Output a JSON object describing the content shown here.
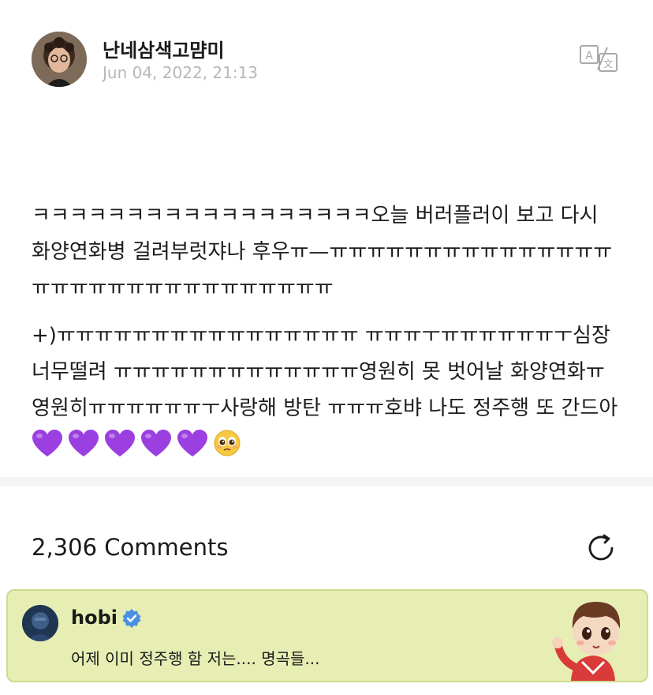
{
  "post": {
    "author": "난네삼색고먐미",
    "date": "Jun 04, 2022, 21:13",
    "body_line1": "ㅋㅋㅋㅋㅋㅋㅋㅋㅋㅋㅋㅋㅋㅋㅋㅋㅋㅋ오늘 버러플러이 보고 다시 화양연화병 걸려부럿쟈나 후우ㅠ—ㅠㅠㅠㅠㅠㅠㅠㅠㅠㅠㅠㅠㅠㅠㅠㅠㅠㅠㅠㅠㅠㅠㅠㅠㅠㅠㅠㅠㅠㅠㅠ",
    "body_line2": "+)ㅠㅠㅠㅠㅠㅠㅠㅠㅠㅠㅠㅠㅠㅠㅠㅠ ㅠㅠㅠㅜㅠㅠㅠㅠㅠㅠㅜ심장너무떨려 ㅠㅠㅠㅠㅠㅠㅠㅠㅠㅠㅠㅠㅠ영원히 못 벗어날 화양연화ㅠ 영원히ㅠㅠㅠㅠㅠㅠㅜ사랑해 방탄 ㅠㅠㅠ호뱌 나도 정주행 또 간드아",
    "heart_count": 5,
    "heart_color": "#9b3fe0",
    "icons": [
      "translate-icon",
      "purple-heart-icon",
      "pleading-face-icon"
    ]
  },
  "comments": {
    "count_label": "2,306 Comments",
    "refresh_icon": "refresh-icon",
    "featured": {
      "author": "hobi",
      "verified_color": "#4a90e2",
      "text": "어제 이미 정주행 함 저는.... 명곡들...",
      "background": "#e7eeb3",
      "sticker": "waving-character-sticker"
    }
  }
}
